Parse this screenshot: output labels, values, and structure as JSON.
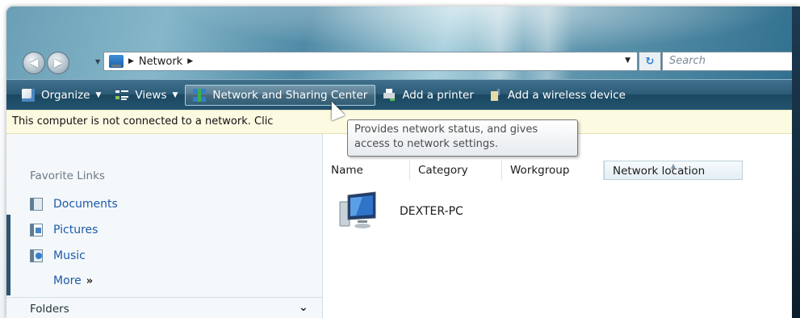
{
  "address_bar": {
    "crumbs": [
      "Network"
    ],
    "search_placeholder": "Search"
  },
  "toolbar": {
    "organize": "Organize",
    "views": "Views",
    "network_sharing": "Network and Sharing Center",
    "add_printer": "Add a printer",
    "add_wireless": "Add a wireless device"
  },
  "infobar": {
    "text": "This computer is not connected to a network. Clic"
  },
  "tooltip": {
    "line1": "Provides network status, and gives",
    "line2": "access to network settings."
  },
  "nav_pane": {
    "favorite_links_title": "Favorite Links",
    "items": [
      "Documents",
      "Pictures",
      "Music"
    ],
    "more": "More",
    "more_glyph": "»",
    "folders": "Folders"
  },
  "content": {
    "columns": [
      "Name",
      "Category",
      "Workgroup",
      "Network location"
    ],
    "sorted_column": "Network location",
    "items": [
      {
        "name": "DEXTER-PC"
      }
    ]
  },
  "colors": {
    "toolbar_bg": "#1b4861",
    "link_blue": "#1e5aa8",
    "infobar_bg": "#fdfae2"
  }
}
